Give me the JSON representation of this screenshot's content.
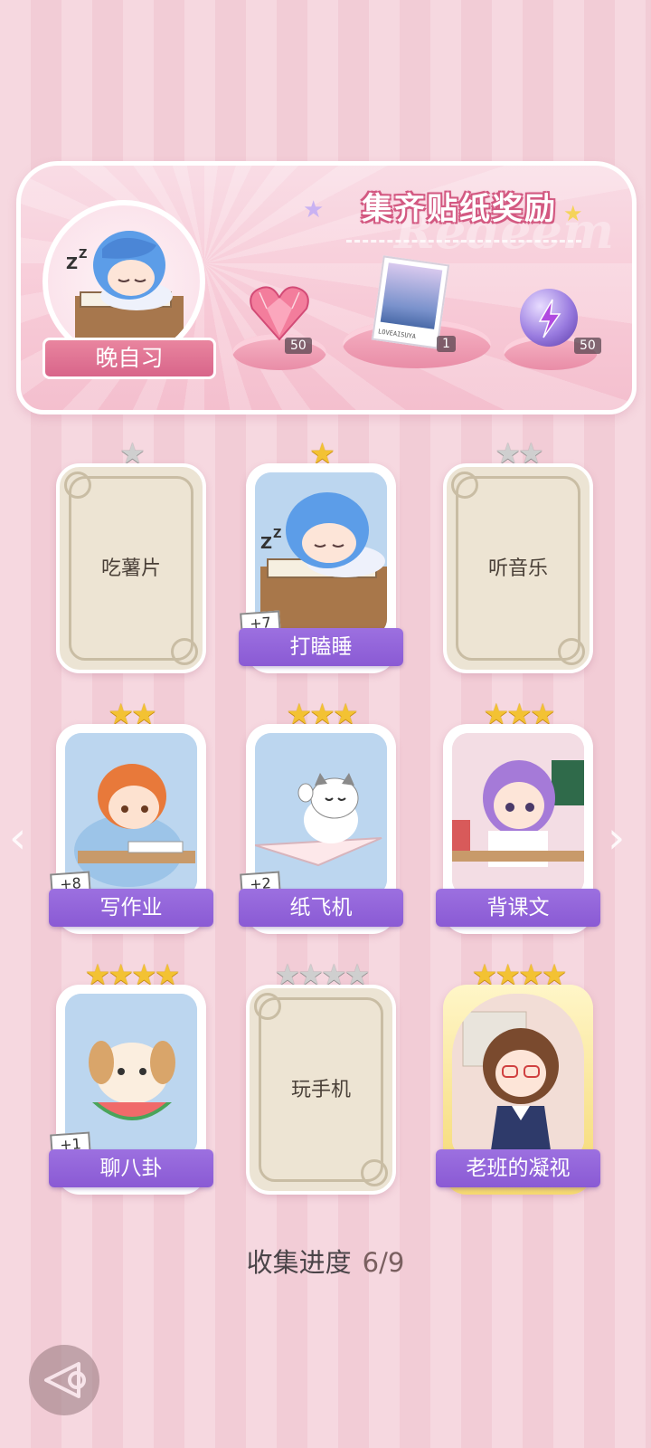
{
  "banner": {
    "title": "集齐贴纸奖励",
    "ghost_text": "Redeem",
    "featured_label": "晚自习",
    "rewards": [
      {
        "icon": "heart-gem-icon",
        "count": "50"
      },
      {
        "icon": "photo-card-icon",
        "count": "1",
        "caption": "LOVEAISUYA"
      },
      {
        "icon": "lightning-orb-icon",
        "count": "50"
      }
    ]
  },
  "cards": [
    {
      "name": "吃薯片",
      "stars": 1,
      "collected": false
    },
    {
      "name": "打瞌睡",
      "stars": 1,
      "collected": true,
      "plus": "+7"
    },
    {
      "name": "听音乐",
      "stars": 2,
      "collected": false
    },
    {
      "name": "写作业",
      "stars": 2,
      "collected": true,
      "plus": "+8"
    },
    {
      "name": "纸飞机",
      "stars": 3,
      "collected": true,
      "plus": "+2"
    },
    {
      "name": "背课文",
      "stars": 3,
      "collected": true
    },
    {
      "name": "聊八卦",
      "stars": 4,
      "collected": true,
      "plus": "+1"
    },
    {
      "name": "玩手机",
      "stars": 4,
      "collected": false
    },
    {
      "name": "老班的凝视",
      "stars": 4,
      "collected": true,
      "gold": true
    }
  ],
  "progress": {
    "label": "收集进度",
    "value": "6/9",
    "collected": 6,
    "total": 9
  },
  "nav": {
    "prev_icon": "chevron-left-icon",
    "next_icon": "chevron-right-icon",
    "back_icon": "back-icon"
  },
  "colors": {
    "ribbon_purple": "#8a5ad4",
    "banner_pink": "#f7c9d6",
    "star_gold": "#f3c233"
  }
}
